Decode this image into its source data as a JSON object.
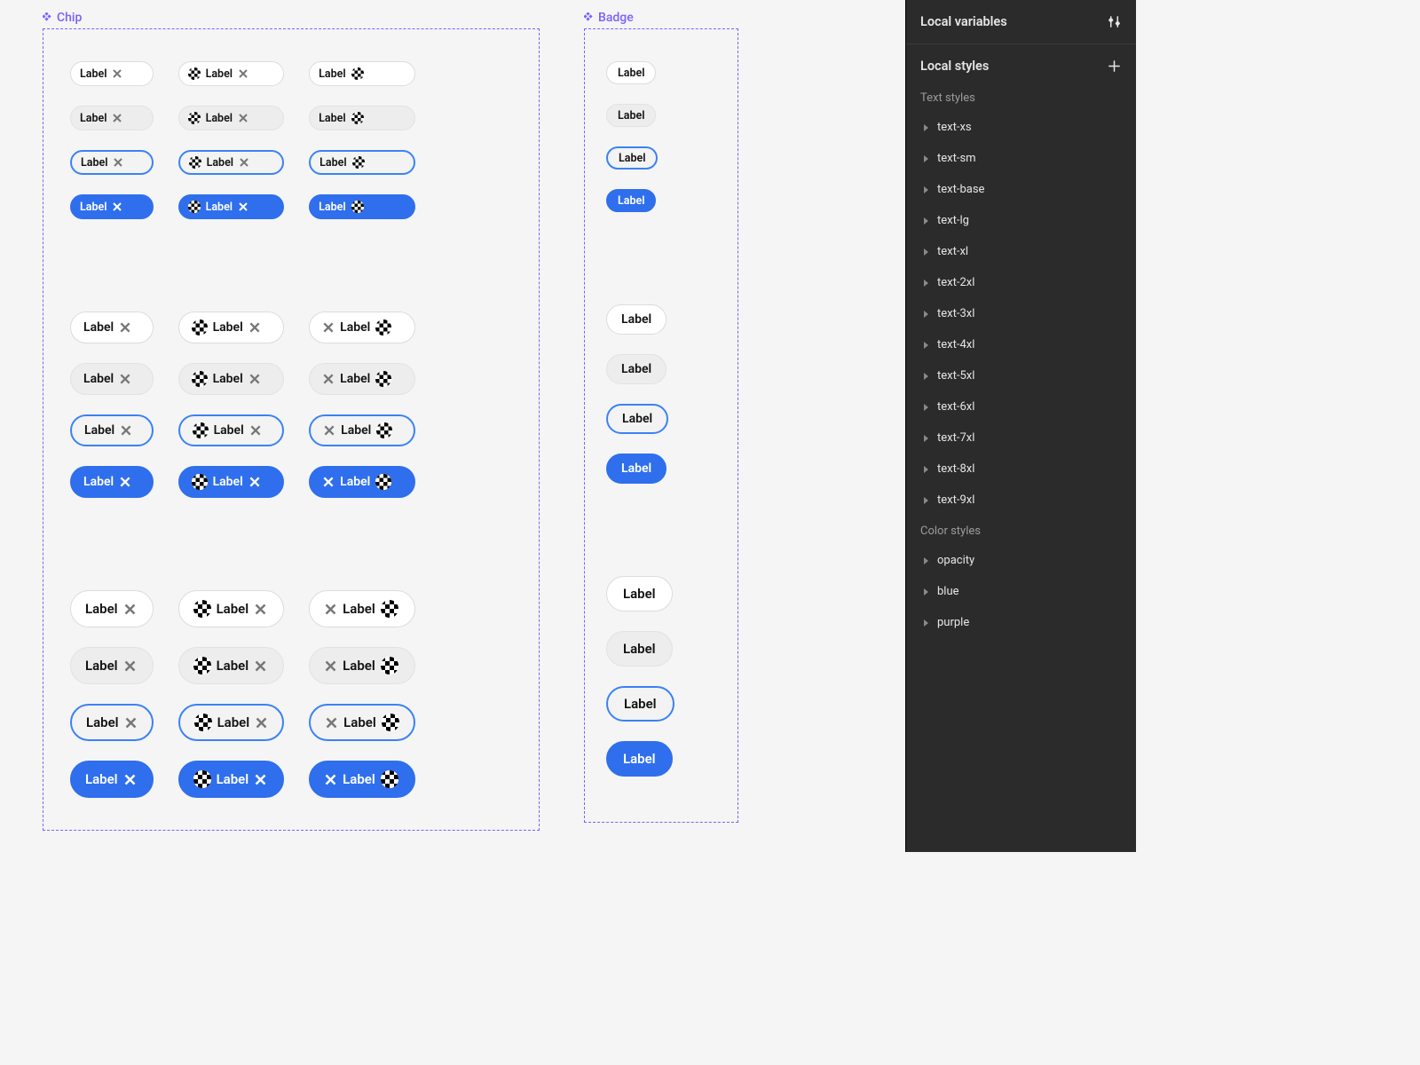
{
  "canvas": {
    "chip_frame_label": "Chip",
    "badge_frame_label": "Badge",
    "chip_label_text": "Label",
    "badge_label_text": "Label",
    "colors": {
      "accent": "#2f6fed",
      "frame_border": "#7b61ff"
    }
  },
  "panel": {
    "local_variables_title": "Local variables",
    "local_styles_title": "Local styles",
    "text_styles_heading": "Text styles",
    "color_styles_heading": "Color styles",
    "text_styles": [
      "text-xs",
      "text-sm",
      "text-base",
      "text-lg",
      "text-xl",
      "text-2xl",
      "text-3xl",
      "text-4xl",
      "text-5xl",
      "text-6xl",
      "text-7xl",
      "text-8xl",
      "text-9xl"
    ],
    "color_styles": [
      "opacity",
      "blue",
      "purple"
    ]
  }
}
